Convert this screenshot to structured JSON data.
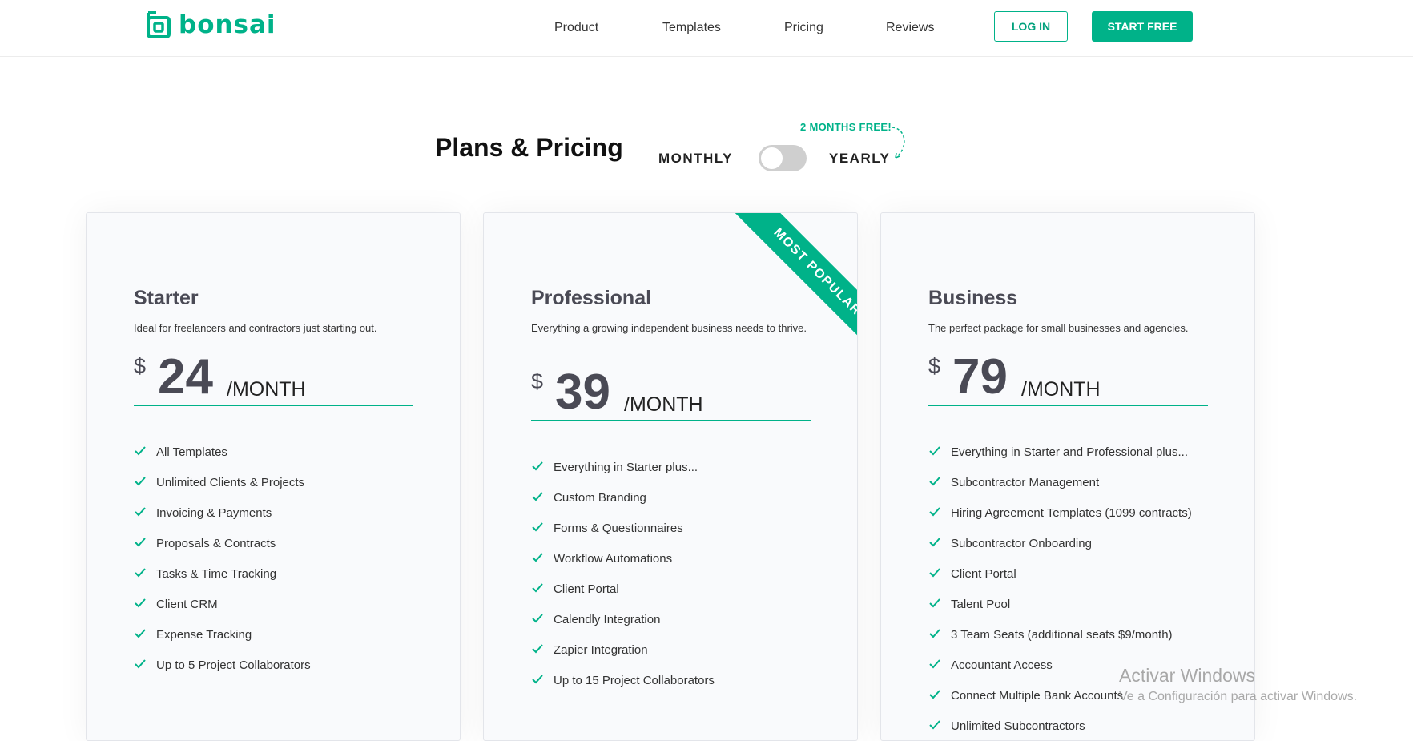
{
  "brand": {
    "name": "bonsai",
    "color": "#00b289",
    "icon": "bonsai-logo-icon"
  },
  "nav": {
    "links": [
      "Product",
      "Templates",
      "Pricing",
      "Reviews"
    ],
    "login_label": "LOG IN",
    "start_label": "START FREE"
  },
  "pricing": {
    "title": "Plans & Pricing",
    "monthly_label": "MONTHLY",
    "yearly_label": "YEARLY",
    "promo": "2 MONTHS FREE!",
    "toggle_yearly_on": false
  },
  "plans": [
    {
      "name": "Starter",
      "description": "Ideal for freelancers and contractors just starting out.",
      "currency": "$",
      "price": "24",
      "period": "/MONTH",
      "features": [
        "All Templates",
        "Unlimited Clients & Projects",
        "Invoicing & Payments",
        "Proposals & Contracts",
        "Tasks & Time Tracking",
        "Client CRM",
        "Expense Tracking",
        "Up to 5 Project Collaborators"
      ]
    },
    {
      "name": "Professional",
      "description": "Everything a growing independent business needs to thrive.",
      "currency": "$",
      "price": "39",
      "period": "/MONTH",
      "ribbon": "MOST POPULAR",
      "features": [
        "Everything in Starter plus...",
        "Custom Branding",
        "Forms & Questionnaires",
        "Workflow Automations",
        "Client Portal",
        "Calendly Integration",
        "Zapier Integration",
        "Up to 15 Project Collaborators"
      ]
    },
    {
      "name": "Business",
      "description": "The perfect package for small businesses and agencies.",
      "currency": "$",
      "price": "79",
      "period": "/MONTH",
      "features": [
        "Everything in Starter and Professional plus...",
        "Subcontractor Management",
        "Hiring Agreement Templates (1099 contracts)",
        "Subcontractor Onboarding",
        "Client Portal",
        "Talent Pool",
        "3 Team Seats (additional seats $9/month)",
        "Accountant Access",
        "Connect Multiple Bank Accounts",
        "Unlimited Subcontractors"
      ]
    }
  ],
  "watermark": {
    "title": "Activar Windows",
    "subtitle": "Ve a Configuración para activar Windows."
  }
}
